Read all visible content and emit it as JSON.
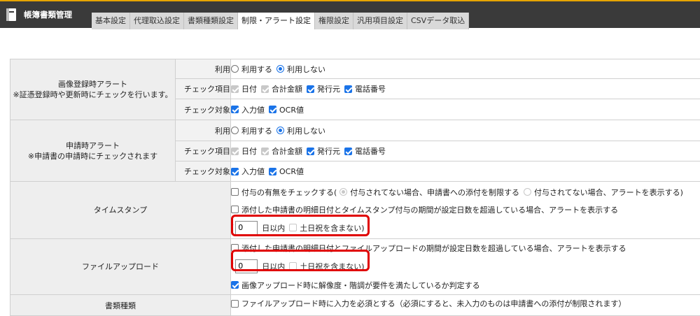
{
  "app": {
    "title": "帳簿書類管理"
  },
  "tabs": [
    {
      "label": "基本設定",
      "active": false
    },
    {
      "label": "代理取込設定",
      "active": false
    },
    {
      "label": "書類種類設定",
      "active": false
    },
    {
      "label": "制限・アラート設定",
      "active": true
    },
    {
      "label": "権限設定",
      "active": false
    },
    {
      "label": "汎用項目設定",
      "active": false
    },
    {
      "label": "CSVデータ取込",
      "active": false
    }
  ],
  "image_alert": {
    "title": "画像登録時アラート",
    "note": "※証憑登録時や更新時にチェックを行います。",
    "use_label": "利用",
    "use_options": [
      "利用する",
      "利用しない"
    ],
    "check_items_label": "チェック項目",
    "check_items": [
      "日付",
      "合計金額",
      "発行元",
      "電話番号"
    ],
    "check_target_label": "チェック対象",
    "check_targets": [
      "入力値",
      "OCR値"
    ]
  },
  "apply_alert": {
    "title": "申請時アラート",
    "note": "※申請書の申請時にチェックされます",
    "use_label": "利用",
    "use_options": [
      "利用する",
      "利用しない"
    ],
    "check_items_label": "チェック項目",
    "check_items": [
      "日付",
      "合計金額",
      "発行元",
      "電話番号"
    ],
    "check_target_label": "チェック対象",
    "check_targets": [
      "入力値",
      "OCR値"
    ]
  },
  "timestamp": {
    "title": "タイムスタンプ",
    "check_label": "付与の有無をチェックする(",
    "option_restrict": "付与されてない場合、申請書への添付を制限する",
    "option_alert": "付与されてない場合、アラートを表示する)",
    "period_label": "添付した申請書の明細日付とタイムスタンプ付与の期間が設定日数を超過している場合、アラートを表示する",
    "paren_open": "(",
    "days_value": "0",
    "days_suffix": "日以内",
    "exclude_holidays": "土日祝を含まない)"
  },
  "file_upload": {
    "title": "ファイルアップロード",
    "period_label": "添付した申請書の明細日付とファイルアップロードの期間が設定日数を超過している場合、アラートを表示する",
    "paren_open": "(",
    "days_value": "0",
    "days_suffix": "日以内",
    "exclude_holidays": "土日祝を含まない)",
    "resolution_label": "画像アップロード時に解像度・階調が要件を満たしているか判定する"
  },
  "doc_type": {
    "title": "書類種類",
    "required_label": "ファイルアップロード時に入力を必須とする（必須にすると、未入力のものは申請書への添付が制限されます）"
  }
}
